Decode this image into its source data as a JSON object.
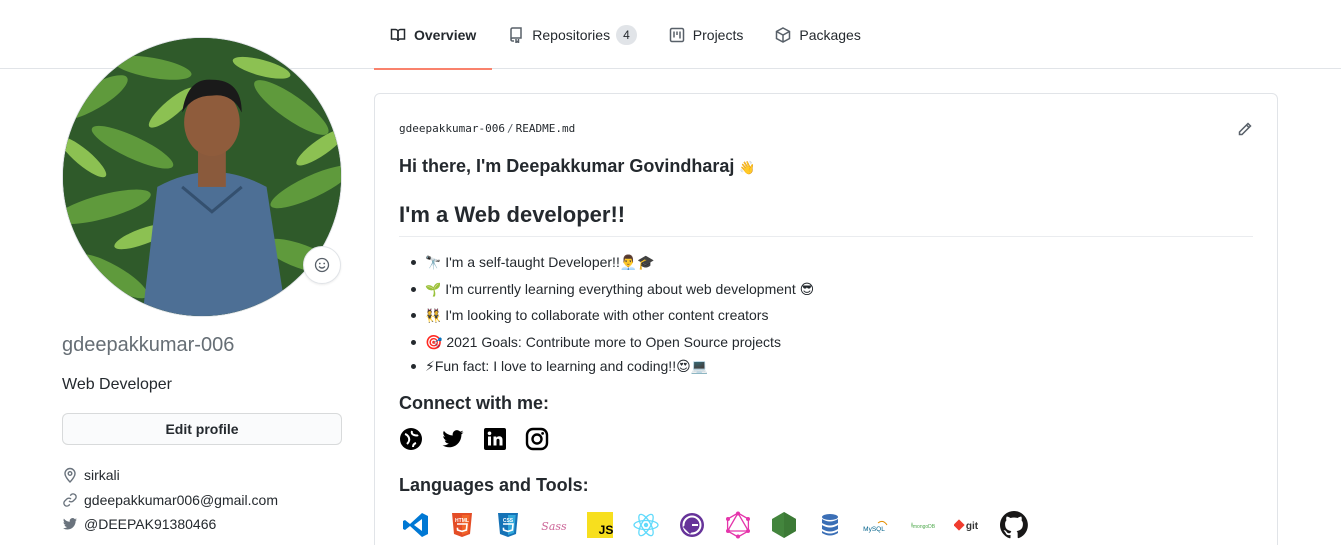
{
  "nav": {
    "tabs": [
      {
        "label": "Overview",
        "active": true
      },
      {
        "label": "Repositories",
        "count": "4"
      },
      {
        "label": "Projects"
      },
      {
        "label": "Packages"
      }
    ],
    "accent": "#f9826c"
  },
  "profile": {
    "username": "gdeepakkumar-006",
    "bio": "Web Developer",
    "edit_label": "Edit profile",
    "location": "sirkali",
    "email": "gdeepakkumar006@gmail.com",
    "twitter": "@DEEPAK91380466"
  },
  "readme": {
    "owner": "gdeepakkumar-006",
    "separator": "/",
    "file": "README.md",
    "greeting": "Hi there, I'm Deepakkumar Govindharaj",
    "greeting_emoji": "👋",
    "heading": "I'm a Web developer!!",
    "items": [
      {
        "emoji": "🔭",
        "text": "I'm a self-taught Developer!!👨‍💼🎓"
      },
      {
        "emoji": "🌱",
        "text": "I'm currently learning everything about web development 😎"
      },
      {
        "emoji": "👯",
        "text": "I'm looking to collaborate with other content creators"
      },
      {
        "emoji": "",
        "text": "🎯 2021 Goals: Contribute more to Open Source projects"
      },
      {
        "emoji": "",
        "text": "⚡Fun fact: I love to learning and coding!!😍💻"
      }
    ],
    "connect_heading": "Connect with me:",
    "socials": [
      "globe-icon",
      "twitter-icon",
      "linkedin-icon",
      "instagram-icon"
    ],
    "tools_heading": "Languages and Tools:",
    "tools": [
      "vscode",
      "html5",
      "css3",
      "sass",
      "javascript",
      "react",
      "gatsby",
      "graphql",
      "nodejs",
      "database",
      "mysql",
      "mongodb",
      "git",
      "github"
    ],
    "tool_labels": {
      "mysql": "MySQL",
      "mongodb": "mongoDB",
      "git": "git",
      "html": "HTML",
      "css": "CSS",
      "js": "JS",
      "sass": "Sass"
    }
  }
}
